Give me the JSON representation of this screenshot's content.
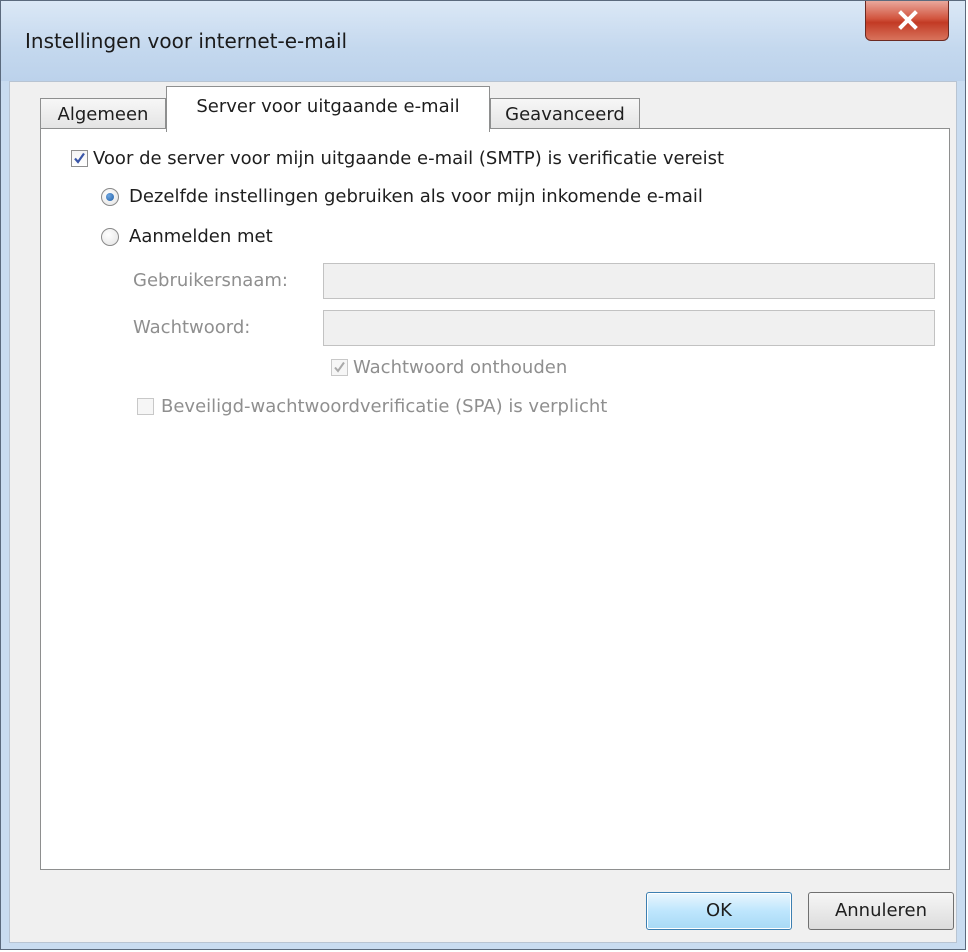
{
  "window": {
    "title": "Instellingen voor internet-e-mail"
  },
  "tabs": [
    {
      "label": "Algemeen"
    },
    {
      "label": "Server voor uitgaande e-mail"
    },
    {
      "label": "Geavanceerd"
    }
  ],
  "smtp": {
    "auth_required_label": "Voor de server voor mijn uitgaande e-mail (SMTP) is verificatie vereist",
    "auth_required_checked": true,
    "same_settings_label": "Dezelfde instellingen gebruiken als voor mijn inkomende e-mail",
    "same_settings_selected": true,
    "login_with_label": "Aanmelden met",
    "login_with_selected": false,
    "username_label": "Gebruikersnaam:",
    "username_value": "",
    "password_label": "Wachtwoord:",
    "password_value": "",
    "remember_password_label": "Wachtwoord onthouden",
    "remember_password_checked": true,
    "spa_label": "Beveiligd-wachtwoordverificatie (SPA) is verplicht",
    "spa_checked": false
  },
  "buttons": {
    "ok": "OK",
    "cancel": "Annuleren"
  },
  "icons": {
    "close": "close-icon",
    "check": "checkmark-icon"
  }
}
